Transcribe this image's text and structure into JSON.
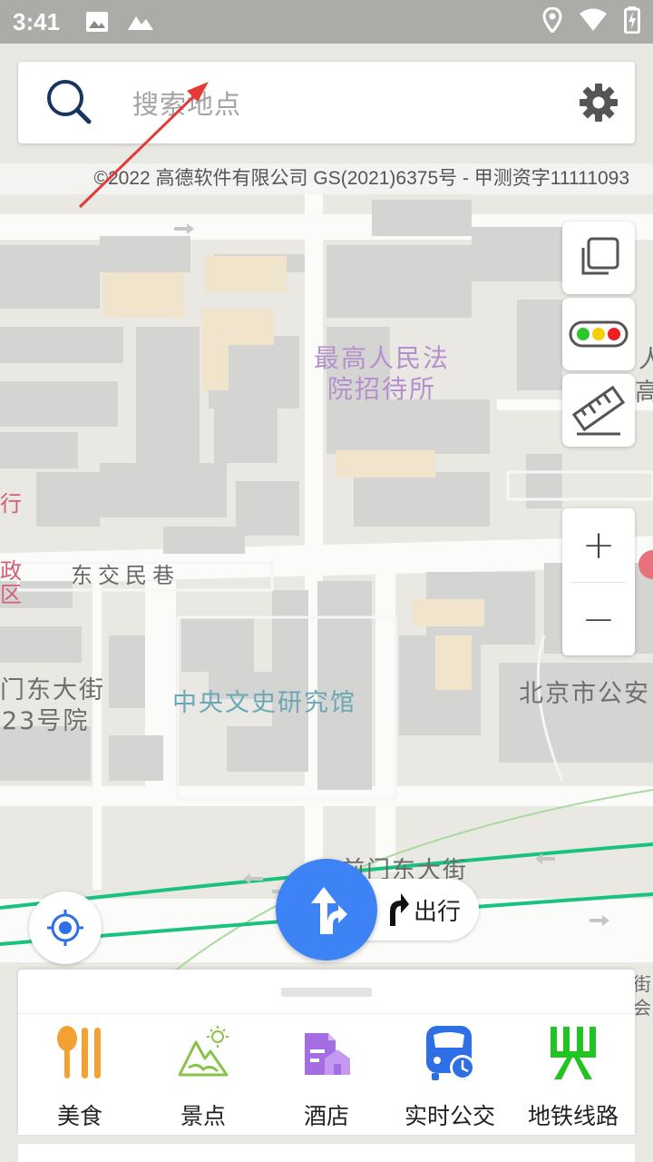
{
  "status_bar": {
    "time": "3:41",
    "left_icons": [
      "image-icon",
      "landscape-icon"
    ],
    "right_icons": [
      "location-icon",
      "wifi-icon",
      "battery-charging-icon"
    ]
  },
  "search": {
    "placeholder": "搜索地点",
    "icon": "search-icon",
    "settings_icon": "gear-icon"
  },
  "copyright": "©2022 高德软件有限公司 GS(2021)6375号 - 甲测资字11111093",
  "map": {
    "labels": {
      "court_hotel_line1": "最高人民法",
      "court_hotel_line2": "院招待所",
      "dongjiao_lane": "东交民巷",
      "west_street_line1": "门东大街",
      "west_street_line2": "23号院",
      "culture_hall": "中央文史研究馆",
      "beijing_city": "北京市公安",
      "main_street": "前门东大街",
      "edge_left_1": "行",
      "edge_left_2_line1": "政",
      "edge_left_2_line2": "区",
      "edge_right_1": "人",
      "edge_right_2": "高",
      "edge_right_3": "街",
      "edge_right_4": "会"
    },
    "colors": {
      "background": "#e9e8e3",
      "road": "#fbfbfa",
      "building": "#d4d5d2",
      "highlight_building": "#f1e4cd",
      "subway": "#19c37d"
    }
  },
  "tools": {
    "layers_icon": "layers-icon",
    "traffic_icon": "traffic-light-icon",
    "ruler_icon": "ruler-icon",
    "zoom_in": "+",
    "zoom_out": "−"
  },
  "go": {
    "label": "出行",
    "icon": "route-arrow-icon"
  },
  "categories": [
    {
      "label": "美食",
      "icon": "food-icon",
      "color": "#f4a133"
    },
    {
      "label": "景点",
      "icon": "scenic-spot-icon",
      "color": "#8bc34a"
    },
    {
      "label": "酒店",
      "icon": "hotel-icon",
      "color": "#a56de2"
    },
    {
      "label": "实时公交",
      "icon": "bus-icon",
      "color": "#2f6fe6"
    },
    {
      "label": "地铁线路",
      "icon": "subway-icon",
      "color": "#22c421"
    }
  ],
  "accent": "#3d83f5"
}
